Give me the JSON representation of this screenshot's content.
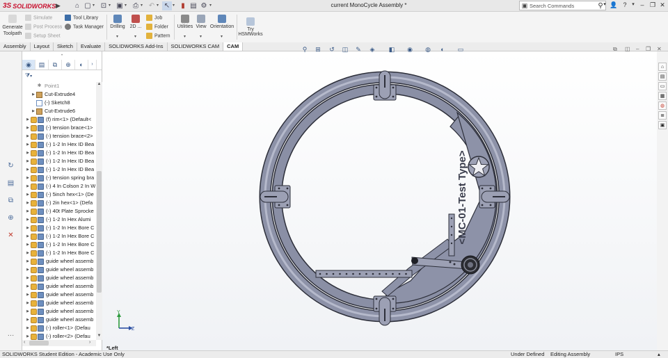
{
  "titlebar": {
    "app_name": "SOLIDWORKS",
    "document_title": "current MonoCycle Assembly *",
    "search_placeholder": "Search Commands",
    "help_icon": "?"
  },
  "ribbon": {
    "generate_toolpath": "Generate Toolpath",
    "simulate": "Simulate",
    "post_process": "Post Process",
    "setup_sheet": "Setup Sheet",
    "tool_library": "Tool Library",
    "task_manager": "Task Manager",
    "drilling": "Drilling",
    "twod": "2D ...",
    "job": "Job",
    "folder": "Folder",
    "pattern": "Pattern",
    "utilities": "Utilities",
    "view": "View",
    "orientation": "Orientation",
    "try_hsmworks_1": "Try",
    "try_hsmworks_2": "HSMWorks"
  },
  "tabs": [
    "Assembly",
    "Layout",
    "Sketch",
    "Evaluate",
    "SOLIDWORKS Add-Ins",
    "SOLIDWORKS CAM",
    "CAM"
  ],
  "tree": {
    "items": [
      {
        "label": "Point1",
        "type": "point",
        "indent": 2,
        "gray": true
      },
      {
        "label": "Cut-Extrude4",
        "type": "feature",
        "indent": 2
      },
      {
        "label": "(-) Sketch8",
        "type": "sketch",
        "indent": 2
      },
      {
        "label": "Cut-Extrude6",
        "type": "feature",
        "indent": 2
      },
      {
        "label": "(f) rim<1> (Default<",
        "type": "part",
        "indent": 0
      },
      {
        "label": "(-) tension brace<1>",
        "type": "part",
        "indent": 0
      },
      {
        "label": "(-) tension brace<2>",
        "type": "part",
        "indent": 0
      },
      {
        "label": "(-) 1-2 In Hex ID Bea",
        "type": "part",
        "indent": 0
      },
      {
        "label": "(-) 1-2 In Hex ID Bea",
        "type": "part",
        "indent": 0
      },
      {
        "label": "(-) 1-2 In Hex ID Bea",
        "type": "part",
        "indent": 0
      },
      {
        "label": "(-) 1-2 In Hex ID Bea",
        "type": "part",
        "indent": 0
      },
      {
        "label": "(-) tension spring bra",
        "type": "part",
        "indent": 0
      },
      {
        "label": "(-) 4 In Colson 2 In W",
        "type": "part",
        "indent": 0
      },
      {
        "label": "(-) 5inch hex<1> (De",
        "type": "part",
        "indent": 0
      },
      {
        "label": "(-) 2in hex<1> (Defa",
        "type": "part",
        "indent": 0
      },
      {
        "label": "(-) 40t Plate Sprocke",
        "type": "part",
        "indent": 0
      },
      {
        "label": "(-) 1-2 In Hex Alumi",
        "type": "part",
        "indent": 0
      },
      {
        "label": "(-) 1-2 In Hex Bore C",
        "type": "part",
        "indent": 0
      },
      {
        "label": "(-) 1-2 In Hex Bore C",
        "type": "part",
        "indent": 0
      },
      {
        "label": "(-) 1-2 In Hex Bore C",
        "type": "part",
        "indent": 0
      },
      {
        "label": "(-) 1-2 In Hex Bore C",
        "type": "part",
        "indent": 0
      },
      {
        "label": "guide wheel assemb",
        "type": "assembly",
        "indent": 0
      },
      {
        "label": "guide wheel assemb",
        "type": "assembly",
        "indent": 0
      },
      {
        "label": "guide wheel assemb",
        "type": "assembly",
        "indent": 0
      },
      {
        "label": "guide wheel assemb",
        "type": "assembly",
        "indent": 0
      },
      {
        "label": "guide wheel assemb",
        "type": "assembly",
        "indent": 0
      },
      {
        "label": "guide wheel assemb",
        "type": "assembly",
        "indent": 0
      },
      {
        "label": "guide wheel assemb",
        "type": "assembly",
        "indent": 0
      },
      {
        "label": "guide wheel assemb",
        "type": "assembly",
        "indent": 0
      },
      {
        "label": "(-) roller<1> (Defau",
        "type": "part",
        "indent": 0
      },
      {
        "label": "(-) roller<2> (Defau",
        "type": "part",
        "indent": 0
      }
    ]
  },
  "viewport": {
    "view_name": "*Left",
    "plate_engraving": "<MC-01-Test Type>",
    "triad_y": "Y",
    "triad_z": "Z"
  },
  "statusbar": {
    "edition": "SOLIDWORKS Student Edition - Academic Use Only",
    "definition": "Under Defined",
    "mode": "Editing Assembly",
    "units": "IPS"
  },
  "colors": {
    "brand_red": "#c8102e",
    "part_fill": "#8c90a6",
    "part_stroke": "#2b2d38",
    "active_tab_bg": "#ffffff"
  }
}
